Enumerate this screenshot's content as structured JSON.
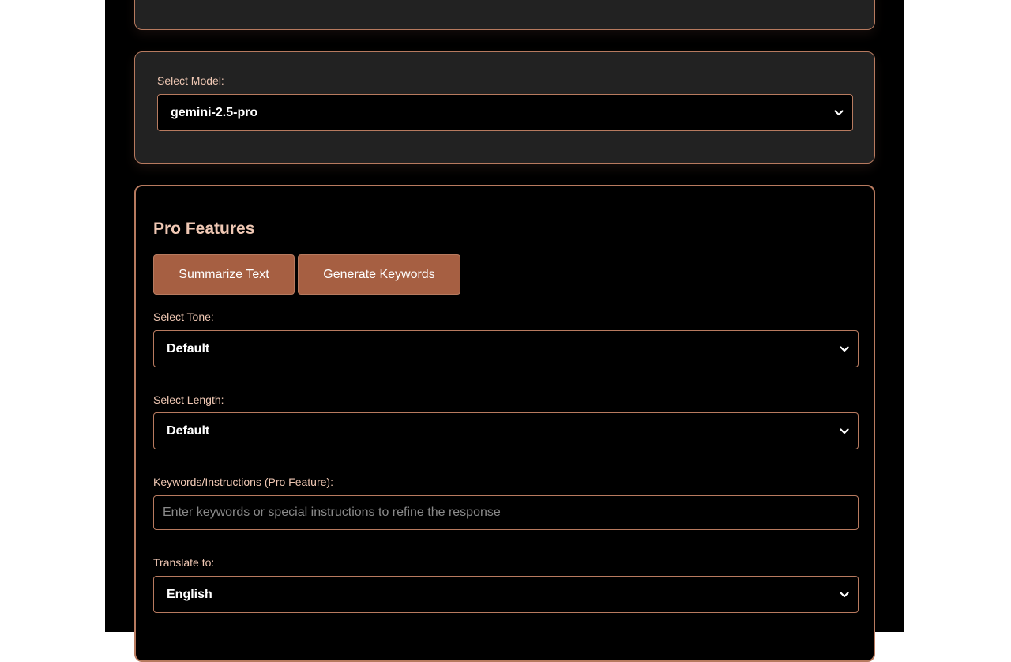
{
  "model_section": {
    "label": "Select Model:",
    "selected": "gemini-2.5-pro"
  },
  "pro_features": {
    "title": "Pro Features",
    "summarize_button": "Summarize Text",
    "keywords_button": "Generate Keywords",
    "tone": {
      "label": "Select Tone:",
      "selected": "Default"
    },
    "length": {
      "label": "Select Length:",
      "selected": "Default"
    },
    "instructions": {
      "label": "Keywords/Instructions (Pro Feature):",
      "value": "",
      "placeholder": "Enter keywords or special instructions to refine the response"
    },
    "translate": {
      "label": "Translate to:",
      "selected": "English"
    }
  },
  "colors": {
    "accent": "#b77a5f",
    "button_bg": "#a65f42",
    "label_text": "#f0c8b4",
    "card_bg": "#222222",
    "page_bg": "#000000"
  },
  "icons": {
    "select_arrow": "chevron-down-icon"
  }
}
